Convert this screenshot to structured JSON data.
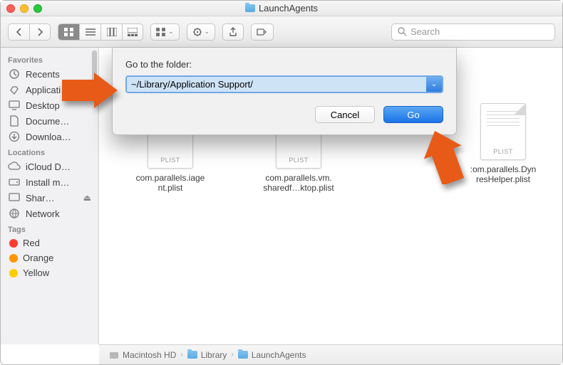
{
  "window": {
    "title": "LaunchAgents"
  },
  "toolbar": {
    "search_placeholder": "Search"
  },
  "sidebar": {
    "favorites": {
      "header": "Favorites",
      "items": [
        {
          "label": "Recents",
          "icon": "clock"
        },
        {
          "label": "Applicati…",
          "icon": "apps"
        },
        {
          "label": "Desktop",
          "icon": "desktop"
        },
        {
          "label": "Docume…",
          "icon": "doc"
        },
        {
          "label": "Downloa…",
          "icon": "download"
        }
      ]
    },
    "locations": {
      "header": "Locations",
      "items": [
        {
          "label": "iCloud D…",
          "icon": "cloud"
        },
        {
          "label": "Install m…",
          "icon": "disk"
        },
        {
          "label": "Shar…",
          "icon": "screen"
        },
        {
          "label": "Network",
          "icon": "globe"
        }
      ]
    },
    "tags": {
      "header": "Tags",
      "items": [
        {
          "label": "Red",
          "color": "#ff3b30"
        },
        {
          "label": "Orange",
          "color": "#ff9500"
        },
        {
          "label": "Yellow",
          "color": "#ffcc00"
        }
      ]
    }
  },
  "files": [
    {
      "name": "com.parallels.iagent.plist",
      "shown": "com.parallels.iage\nnt.plist",
      "badge": "PLIST"
    },
    {
      "name": "com.parallels.vm.sharedf…ktop.plist",
      "shown": "com.parallels.vm.\nsharedf…ktop.plist",
      "badge": "PLIST"
    },
    {
      "name": "com.parallels.DynresHelper.plist",
      "shown": ":om.parallels.Dyn\nresHelper.plist",
      "badge": "PLIST",
      "partial": true
    }
  ],
  "pathbar": [
    "Macintosh HD",
    "Library",
    "LaunchAgents"
  ],
  "sheet": {
    "label": "Go to the folder:",
    "path": "~/Library/Application Support/",
    "cancel": "Cancel",
    "go": "Go"
  }
}
